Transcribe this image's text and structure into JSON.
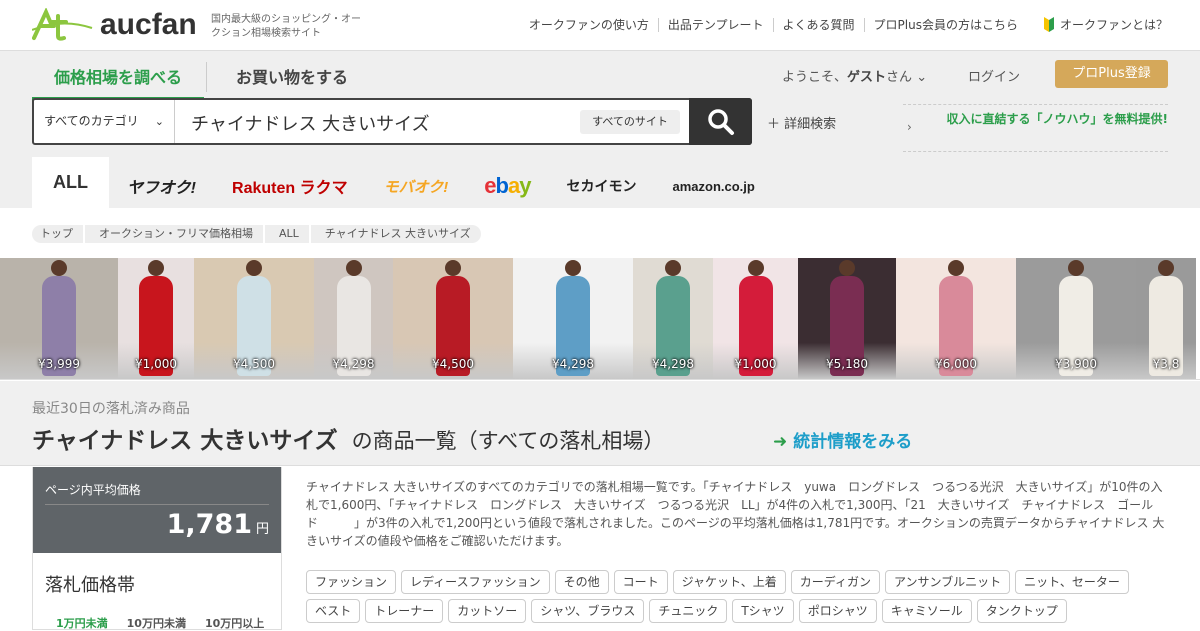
{
  "header": {
    "logo_text": "aucfan",
    "tagline": "国内最大級のショッピング・オークション相場検索サイト",
    "nav": [
      "オークファンの使い方",
      "出品テンプレート",
      "よくある質問",
      "プロPlus会員の方はこちら"
    ],
    "about": "オークファンとは？"
  },
  "tabs": {
    "price": "価格相場を調べる",
    "shop": "お買い物をする"
  },
  "account": {
    "welcome_prefix": "ようこそ、",
    "guest": "ゲスト",
    "welcome_suffix": "さん",
    "login": "ログイン",
    "register": "プロPlus登録"
  },
  "search": {
    "category": "すべてのカテゴリ",
    "query": "チャイナドレス 大きいサイズ",
    "site": "すべてのサイト",
    "advanced": "詳細検索",
    "promo": "収入に直結する「ノウハウ」を無料提供!"
  },
  "sites": [
    {
      "label": "ALL",
      "color": "#333333"
    },
    {
      "label": "ヤフオク!",
      "color": "#222222"
    },
    {
      "label": "Rakuten ラクマ",
      "color": "#bf0000"
    },
    {
      "label": "モバオク!",
      "color": "#f5a623"
    },
    {
      "label": "ebay",
      "color": "#e53238"
    },
    {
      "label": "セカイモン",
      "color": "#222222"
    },
    {
      "label": "amazon.co.jp",
      "color": "#222222"
    }
  ],
  "breadcrumb": [
    "トップ",
    "オークション・フリマ価格相場",
    "ALL",
    "チャイナドレス 大きいサイズ"
  ],
  "thumbnails": [
    {
      "price": "¥3,999",
      "bg": "#b9b3aa",
      "dress": "#8e7fa8"
    },
    {
      "price": "¥1,000",
      "bg": "#e8e0e0",
      "dress": "#c8151d"
    },
    {
      "price": "¥4,500",
      "bg": "#d9c9b2",
      "dress": "#cfe0e6"
    },
    {
      "price": "¥4,298",
      "bg": "#cfc6c0",
      "dress": "#e9e6e3"
    },
    {
      "price": "¥4,500",
      "bg": "#d8c7b4",
      "dress": "#b81b25"
    },
    {
      "price": "¥4,298",
      "bg": "#f2f2f2",
      "dress": "#5e9ec6"
    },
    {
      "price": "¥4,298",
      "bg": "#e0dbd3",
      "dress": "#5aa08e"
    },
    {
      "price": "¥1,000",
      "bg": "#f1e4e6",
      "dress": "#d41c3a"
    },
    {
      "price": "¥5,180",
      "bg": "#3b2d32",
      "dress": "#7a2d52"
    },
    {
      "price": "¥6,000",
      "bg": "#f3e5df",
      "dress": "#d98a9a"
    },
    {
      "price": "¥3,900",
      "bg": "#9b9b9b",
      "dress": "#f0ede6"
    },
    {
      "price": "¥3,8",
      "bg": "#9a9a9a",
      "dress": "#eeeae2"
    }
  ],
  "list": {
    "subtitle": "最近30日の落札済み商品",
    "title_keyword": "チャイナドレス 大きいサイズ",
    "title_rest": "の商品一覧（すべての落札相場）",
    "stats_link": "統計情報をみる"
  },
  "avg": {
    "label": "ページ内平均価格",
    "value": "1,781",
    "unit": "円"
  },
  "bands": {
    "title": "落札価格帯",
    "items": [
      "1万円未満",
      "10万円未満",
      "10万円以上"
    ]
  },
  "description": "チャイナドレス 大きいサイズのすべてのカテゴリでの落札相場一覧です。「チャイナドレス　yuwa　ロングドレス　つるつる光沢　大きいサイズ」が10件の入札で1,600円、「チャイナドレス　ロングドレス　大きいサイズ　つるつる光沢　LL」が4件の入札で1,300円、「21　大きいサイズ　チャイナドレス　ゴールド　　　」が3件の入札で1,200円という値段で落札されました。このページの平均落札価格は1,781円です。オークションの売買データからチャイナドレス 大きいサイズの値段や価格をご確認いただけます。",
  "tags": [
    "ファッション",
    "レディースファッション",
    "その他",
    "コート",
    "ジャケット、上着",
    "カーディガン",
    "アンサンブルニット",
    "ニット、セーター",
    "ベスト",
    "トレーナー",
    "カットソー",
    "シャツ、ブラウス",
    "チュニック",
    "Tシャツ",
    "ポロシャツ",
    "キャミソール",
    "タンクトップ"
  ]
}
